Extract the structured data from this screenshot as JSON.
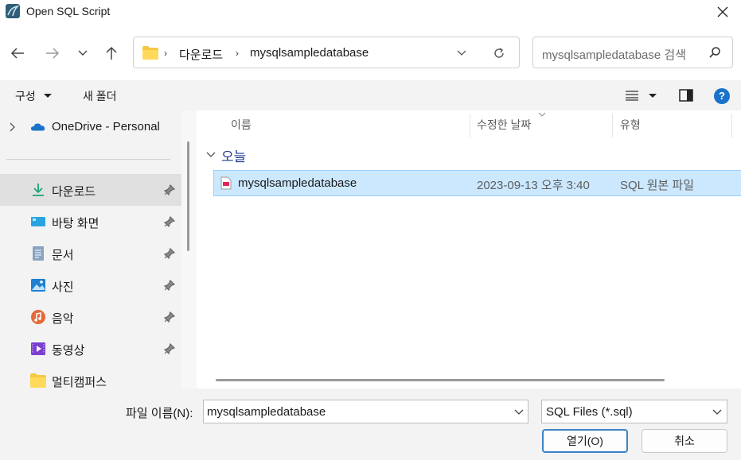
{
  "window": {
    "title": "Open SQL Script"
  },
  "address": {
    "crumbs": [
      "다운로드",
      "mysqlsampledatabase"
    ],
    "search_placeholder": "mysqlsampledatabase 검색"
  },
  "commandbar": {
    "organize_label": "구성",
    "new_folder_label": "새 폴더"
  },
  "navigation": {
    "onedrive_label": "OneDrive - Personal",
    "items": [
      {
        "label": "다운로드",
        "icon": "download-arrow-icon",
        "pinned": true,
        "selected": true
      },
      {
        "label": "바탕 화면",
        "icon": "desktop-icon",
        "pinned": true
      },
      {
        "label": "문서",
        "icon": "document-icon",
        "pinned": true
      },
      {
        "label": "사진",
        "icon": "pictures-icon",
        "pinned": true
      },
      {
        "label": "음악",
        "icon": "music-icon",
        "pinned": true
      },
      {
        "label": "동영상",
        "icon": "video-icon",
        "pinned": true
      },
      {
        "label": "멀티캠퍼스",
        "icon": "folder-icon",
        "pinned": false
      }
    ]
  },
  "filelist": {
    "columns": {
      "name": "이름",
      "date": "수정한 날짜",
      "type": "유형"
    },
    "group": "오늘",
    "files": [
      {
        "name": "mysqlsampledatabase",
        "date": "2023-09-13 오후 3:40",
        "type": "SQL 원본 파일",
        "selected": true
      }
    ]
  },
  "footer": {
    "filename_label": "파일 이름(N):",
    "filename_value": "mysqlsampledatabase",
    "filter_value": "SQL Files (*.sql)",
    "open_label": "열기(O)",
    "cancel_label": "취소"
  },
  "colors": {
    "accent": "#1a73c9",
    "selection_bg": "#cce8ff",
    "folder": "#f5c842",
    "pane_bg": "#f3f3f3"
  }
}
